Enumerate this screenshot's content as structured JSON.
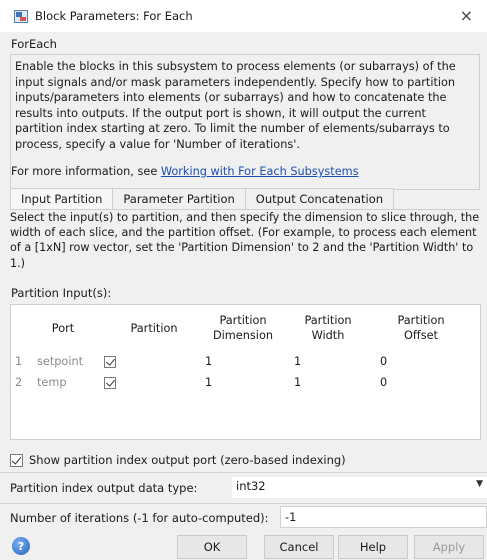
{
  "window": {
    "title": "Block Parameters: For Each",
    "close_glyph": "×"
  },
  "block": {
    "name": "ForEach",
    "description": "Enable the blocks in this subsystem to process elements (or subarrays) of the input signals and/or mask parameters independently. Specify how to partition inputs/parameters into elements (or subarrays) and how to concatenate the results into outputs. If the output port is shown, it will output the current partition index starting at zero.  To limit the number of elements/subarrays to process, specify a value for 'Number of iterations'.",
    "more_info_prefix": "For more information, see ",
    "more_info_link": "Working with For Each Subsystems"
  },
  "tabs": [
    {
      "label": "Input Partition",
      "active": true
    },
    {
      "label": "Parameter Partition",
      "active": false
    },
    {
      "label": "Output Concatenation",
      "active": false
    }
  ],
  "input_partition": {
    "description": "Select the input(s) to partition, and then specify the dimension to slice through, the width of each slice, and the partition offset. (For example, to process each element of a [1xN] row vector, set the 'Partition Dimension' to 2 and the 'Partition Width' to 1.)",
    "table_label": "Partition Input(s):",
    "columns": [
      "Port",
      "Partition",
      "Partition\nDimension",
      "Partition\nWidth",
      "Partition\nOffset"
    ],
    "rows": [
      {
        "index": "1",
        "port": "setpoint",
        "partition": true,
        "dimension": "1",
        "width": "1",
        "offset": "0"
      },
      {
        "index": "2",
        "port": "temp",
        "partition": true,
        "dimension": "1",
        "width": "1",
        "offset": "0"
      }
    ]
  },
  "options": {
    "show_port_label": "Show partition index output port (zero-based indexing)",
    "show_port_checked": true,
    "dtype_label": "Partition index output data type:",
    "dtype_value": "int32",
    "dtype_caret": "▼",
    "iterations_label": "Number of iterations (-1 for auto-computed):",
    "iterations_value": "-1"
  },
  "buttons": {
    "help_glyph": "?",
    "ok": "OK",
    "cancel": "Cancel",
    "help": "Help",
    "apply": "Apply"
  }
}
